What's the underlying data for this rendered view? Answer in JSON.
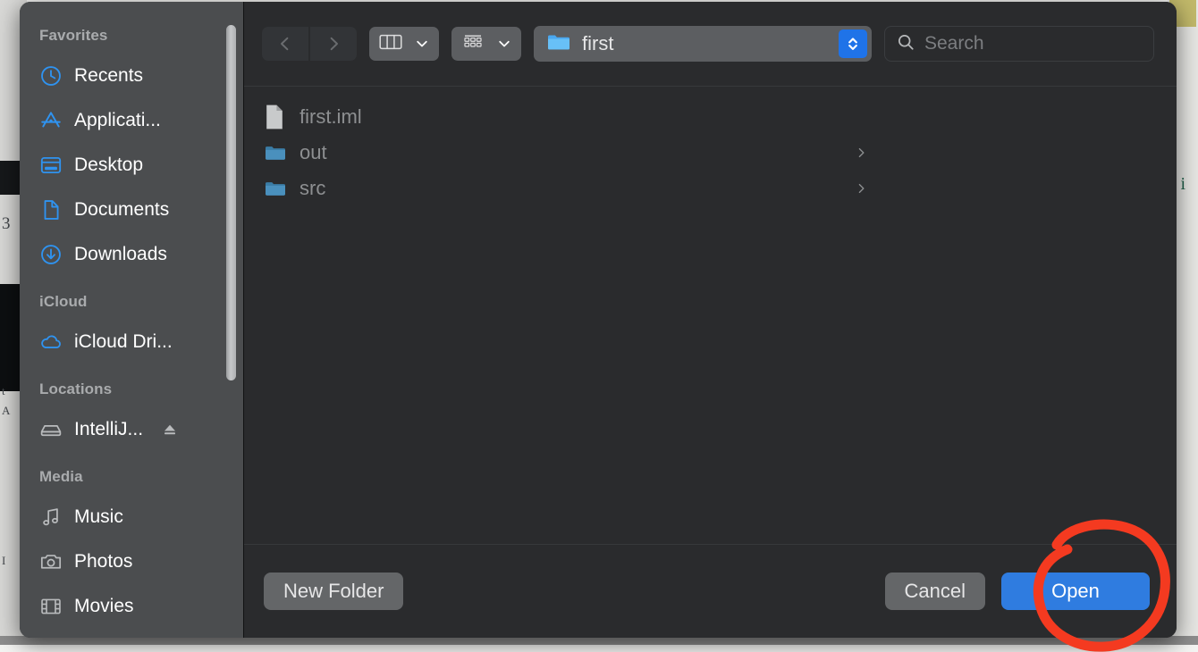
{
  "dialog": {
    "type": "macos-open-file-sheet",
    "appearance": "dark"
  },
  "sidebar": {
    "groups": [
      {
        "title": "Favorites",
        "items": [
          {
            "label": "Recents",
            "icon": "clock-icon",
            "icon_color": "#2f93f0"
          },
          {
            "label": "Applicati...",
            "icon": "applications-icon",
            "icon_color": "#2f93f0"
          },
          {
            "label": "Desktop",
            "icon": "desktop-icon",
            "icon_color": "#2f93f0"
          },
          {
            "label": "Documents",
            "icon": "document-icon",
            "icon_color": "#2f93f0"
          },
          {
            "label": "Downloads",
            "icon": "download-icon",
            "icon_color": "#2f93f0"
          }
        ]
      },
      {
        "title": "iCloud",
        "items": [
          {
            "label": "iCloud Dri...",
            "icon": "cloud-icon",
            "icon_color": "#2f93f0"
          }
        ]
      },
      {
        "title": "Locations",
        "items": [
          {
            "label": "IntelliJ...",
            "icon": "disk-icon",
            "icon_color": "#b9bbbd",
            "eject": true
          }
        ]
      },
      {
        "title": "Media",
        "items": [
          {
            "label": "Music",
            "icon": "music-note-icon",
            "icon_color": "#b9bbbd"
          },
          {
            "label": "Photos",
            "icon": "camera-icon",
            "icon_color": "#b9bbbd"
          },
          {
            "label": "Movies",
            "icon": "film-icon",
            "icon_color": "#b9bbbd"
          }
        ]
      }
    ]
  },
  "toolbar": {
    "back_label": "Back",
    "forward_label": "Forward",
    "view_mode_label": "Column View",
    "group_mode_label": "Icon Options",
    "path": {
      "folder_name": "first",
      "icon": "folder-icon"
    },
    "search": {
      "placeholder": "Search",
      "value": ""
    }
  },
  "files": {
    "items": [
      {
        "name": "first.iml",
        "icon": "file-icon",
        "kind": "file",
        "has_children": false
      },
      {
        "name": "out",
        "icon": "folder-icon",
        "kind": "folder",
        "has_children": true
      },
      {
        "name": "src",
        "icon": "folder-icon",
        "kind": "folder",
        "has_children": true
      }
    ]
  },
  "buttons": {
    "new_folder": "New Folder",
    "cancel": "Cancel",
    "open": "Open"
  },
  "annotation": {
    "shape": "hand-drawn-circle",
    "color": "#f43a20",
    "targets": "open-button"
  },
  "colors": {
    "accent_blue": "#2f7ce0",
    "sidebar_bg": "#4b4d4f",
    "content_bg": "#2a2b2d",
    "icon_blue": "#2f93f0",
    "annotation_red": "#f43a20"
  }
}
